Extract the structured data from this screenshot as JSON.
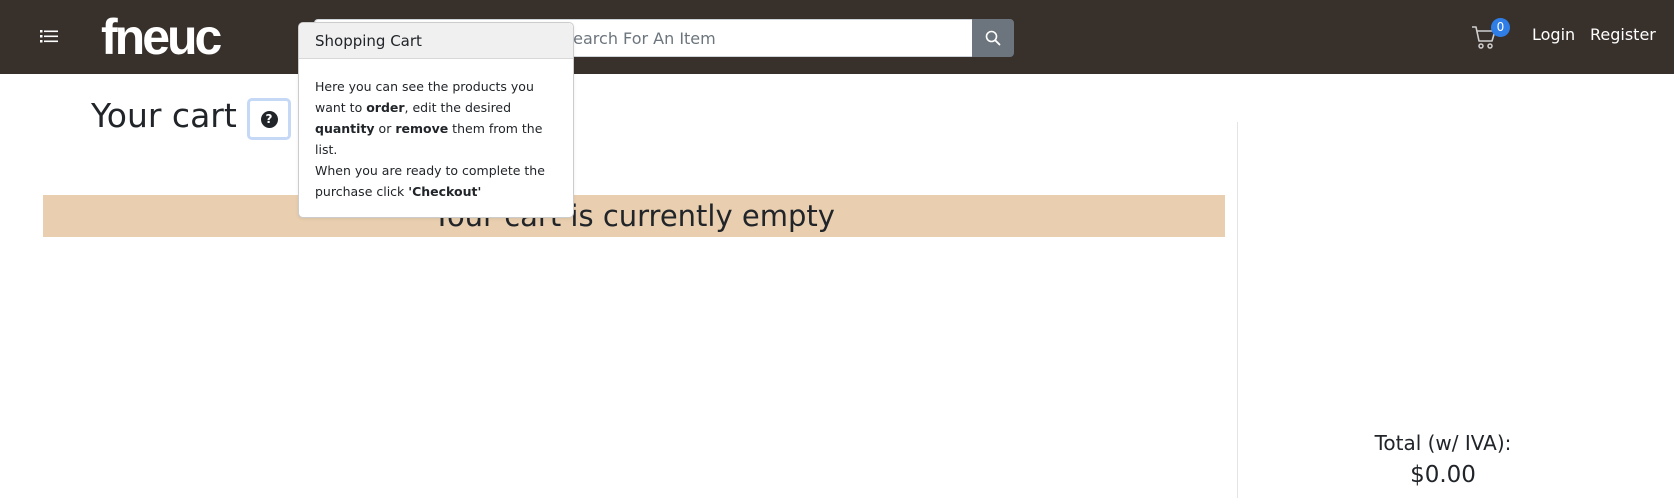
{
  "header": {
    "logo_text": "fneuc",
    "search": {
      "placeholder": "Search For An Item"
    },
    "cart": {
      "count": "0"
    },
    "login_label": "Login",
    "register_label": "Register"
  },
  "main": {
    "heading": "Your cart",
    "help_icon_glyph": "?",
    "empty_message": "Your cart is currently empty"
  },
  "summary": {
    "total_label": "Total (w/ IVA):",
    "total_value": "$0.00"
  },
  "popover": {
    "title": "Shopping Cart",
    "line1_a": "Here you can see the products you want to ",
    "line1_order": "order",
    "line1_b": ", edit the desired ",
    "line1_quantity": "quantity",
    "line1_c": " or ",
    "line1_remove": "remove",
    "line1_d": " them from the list.",
    "line2_a": "When you are ready to complete the purchase click ",
    "line2_checkout": "'Checkout'"
  },
  "icons": {
    "menu": "list-icon",
    "search": "search-icon",
    "cart": "cart-icon",
    "help": "question-circle-icon"
  },
  "colors": {
    "navbar": "#38302b",
    "empty_banner": "#e9cfaf",
    "badge": "#2f7ee8",
    "search_button": "#6c757d"
  }
}
